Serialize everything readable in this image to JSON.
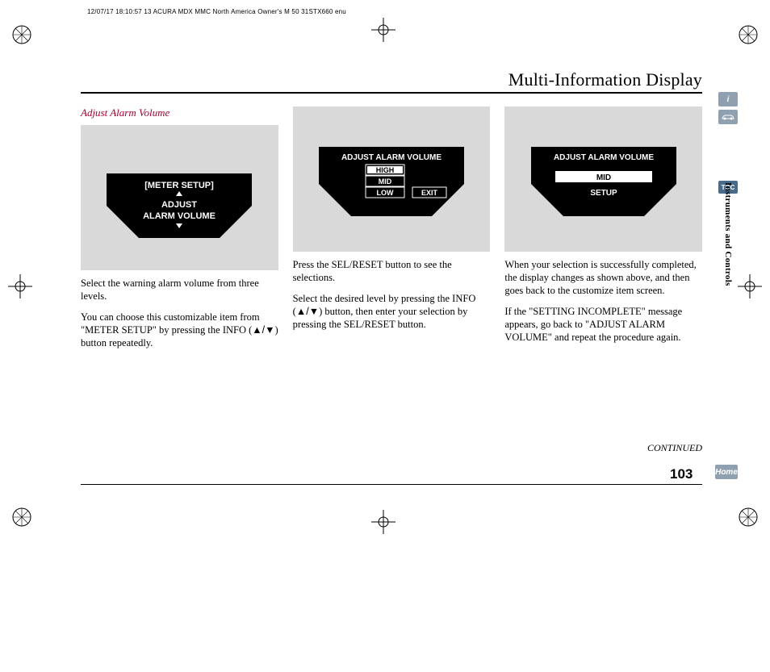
{
  "meta_header": "12/07/17 18:10:57   13 ACURA MDX MMC North America Owner's M 50 31STX660 enu",
  "page_title": "Multi-Information Display",
  "section_label": "Instruments and Controls",
  "continued": "CONTINUED",
  "page_number": "103",
  "side": {
    "info": "i",
    "car": "🚗",
    "toc": "TOC",
    "home": "Home"
  },
  "col1": {
    "heading": "Adjust Alarm Volume",
    "display": {
      "line1": "[METER SETUP]",
      "line2": "ADJUST",
      "line3": "ALARM VOLUME"
    },
    "p1": "Select the warning alarm volume from three levels.",
    "p2_a": "You can choose this customizable item from \"METER SETUP\" by pressing the INFO (",
    "p2_b": ") button repeatedly."
  },
  "col2": {
    "display": {
      "title": "ADJUST ALARM VOLUME",
      "opt1": "HIGH",
      "opt2": "MID",
      "opt3": "LOW",
      "exit": "EXIT"
    },
    "p1": "Press the SEL/RESET button to see the selections.",
    "p2_a": "Select the desired level by pressing the INFO (",
    "p2_b": ") button, then enter your selection by pressing the SEL/RESET button."
  },
  "col3": {
    "display": {
      "title": "ADJUST ALARM VOLUME",
      "sel": "MID",
      "setup": "SETUP"
    },
    "p1": "When your selection is successfully completed, the display changes as shown above, and then goes back to the customize item screen.",
    "p2": "If the \"SETTING INCOMPLETE\" message appears, go back to \"ADJUST ALARM VOLUME\" and repeat the procedure again."
  }
}
